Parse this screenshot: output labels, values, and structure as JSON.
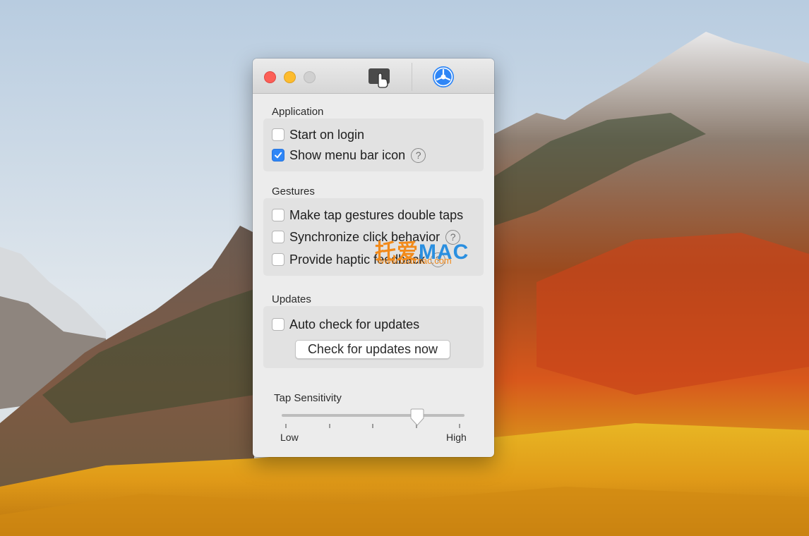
{
  "window": {
    "toolbar": {
      "gestures_icon": "hand-tap-icon",
      "general_icon": "gear-icon"
    },
    "sections": {
      "application": {
        "label": "Application",
        "start_on_login": {
          "label": "Start on login",
          "checked": false
        },
        "show_menu_bar_icon": {
          "label": "Show menu bar icon",
          "checked": true
        }
      },
      "gestures": {
        "label": "Gestures",
        "double_taps": {
          "label": "Make tap gestures double taps",
          "checked": false
        },
        "sync_click": {
          "label": "Synchronize click behavior",
          "checked": false
        },
        "haptic": {
          "label": "Provide haptic feedback",
          "checked": false
        }
      },
      "updates": {
        "label": "Updates",
        "auto_check": {
          "label": "Auto check for updates",
          "checked": false
        },
        "check_now_label": "Check for updates now"
      }
    },
    "tap_sensitivity": {
      "title": "Tap Sensitivity",
      "low_label": "Low",
      "high_label": "High",
      "value_fraction": 0.74
    },
    "help_glyph": "?"
  },
  "watermark": {
    "cn": "托爱",
    "mac": "MAC",
    "url": "www.tuaimac.com"
  },
  "colors": {
    "checkbox_accent": "#2f86f6",
    "close": "#fc5f57",
    "minimize": "#fdbc2e",
    "zoom_disabled": "#d0d0d0",
    "toolbar_accent": "#2f86f6"
  }
}
